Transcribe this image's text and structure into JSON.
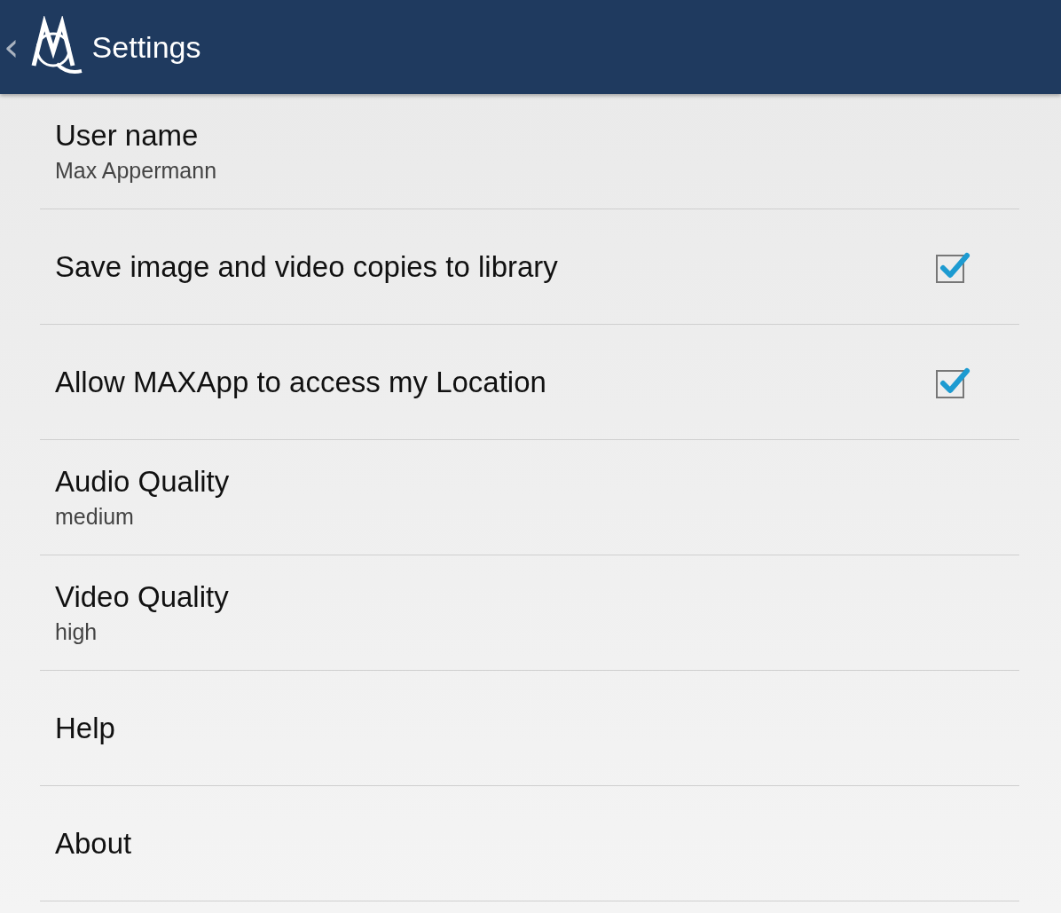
{
  "action_bar": {
    "back": "‹",
    "title": "Settings"
  },
  "settings": [
    {
      "kind": "text",
      "title": "User name",
      "summary": "Max Appermann"
    },
    {
      "kind": "checkbox",
      "title": "Save image and video copies to library",
      "checked": true
    },
    {
      "kind": "checkbox",
      "title": "Allow MAXApp to access my Location",
      "checked": true
    },
    {
      "kind": "text",
      "title": "Audio Quality",
      "summary": "medium"
    },
    {
      "kind": "text",
      "title": "Video Quality",
      "summary": "high"
    },
    {
      "kind": "text",
      "title": "Help"
    },
    {
      "kind": "text",
      "title": "About"
    }
  ]
}
